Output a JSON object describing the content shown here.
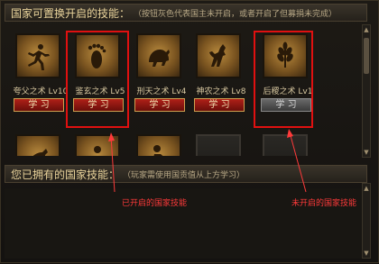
{
  "available_section": {
    "title": "国家可置换开启的技能：",
    "hint": "（按钮灰色代表国主未开启，或者开启了但募捐未完成）"
  },
  "skills": [
    {
      "name": "夸父之术 Lv10",
      "icon": "running-figure-icon",
      "button": "学 习",
      "state": "red"
    },
    {
      "name": "鉴玄之术 Lv5",
      "icon": "footprint-icon",
      "button": "学 习",
      "state": "red"
    },
    {
      "name": "刑天之术 Lv4",
      "icon": "beast-icon",
      "button": "学 习",
      "state": "red"
    },
    {
      "name": "神农之术 Lv8",
      "icon": "ox-icon",
      "button": "学 习",
      "state": "red"
    },
    {
      "name": "后稷之术 Lv1",
      "icon": "wheat-icon",
      "button": "学 习",
      "state": "gray"
    }
  ],
  "owned_section": {
    "title": "您已拥有的国家技能：",
    "hint": "（玩家需使用国贡值从上方学习）"
  },
  "annotations": {
    "enabled": "已开启的国家技能",
    "disabled": "未开启的国家技能",
    "color": "#ff3a3a"
  }
}
